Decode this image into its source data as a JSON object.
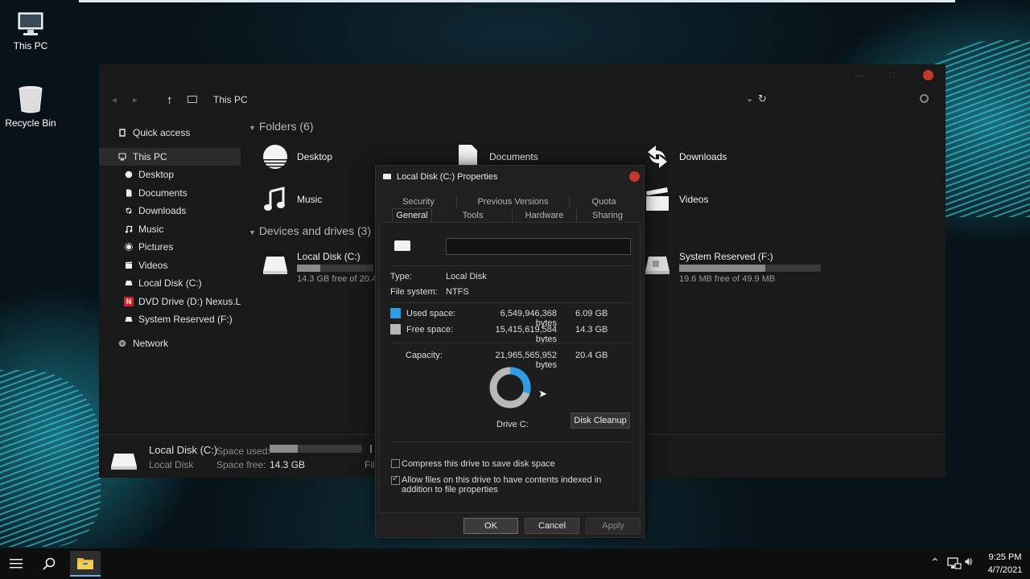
{
  "desktop": {
    "icons": [
      {
        "label": "This PC",
        "icon": "computer-icon"
      },
      {
        "label": "Recycle Bin",
        "icon": "recycle-bin-icon"
      }
    ]
  },
  "explorer": {
    "breadcrumb": "This PC",
    "nav_back_icon": "back-arrow-icon",
    "nav_forward_icon": "forward-arrow-icon",
    "up_icon": "up-arrow-icon",
    "sidebar": {
      "quick_access": "Quick access",
      "this_pc": "This PC",
      "items": [
        {
          "label": "Desktop",
          "icon": "desktop-icon"
        },
        {
          "label": "Documents",
          "icon": "document-icon"
        },
        {
          "label": "Downloads",
          "icon": "downloads-icon"
        },
        {
          "label": "Music",
          "icon": "music-icon"
        },
        {
          "label": "Pictures",
          "icon": "pictures-icon"
        },
        {
          "label": "Videos",
          "icon": "videos-icon"
        },
        {
          "label": "Local Disk (C:)",
          "icon": "drive-icon"
        },
        {
          "label": "DVD Drive (D:) Nexus.Lite",
          "icon": "dvd-drive-icon"
        },
        {
          "label": "System Reserved (F:)",
          "icon": "drive-icon"
        }
      ],
      "network": "Network"
    },
    "groups": {
      "folders_header": "Folders (6)",
      "devices_header": "Devices and drives (3)"
    },
    "folders": [
      {
        "name": "Desktop",
        "icon": "desktop-folder-icon"
      },
      {
        "name": "Documents",
        "icon": "documents-folder-icon"
      },
      {
        "name": "Downloads",
        "icon": "downloads-folder-icon"
      },
      {
        "name": "Music",
        "icon": "music-folder-icon"
      },
      {
        "name": "Videos",
        "icon": "videos-folder-icon"
      }
    ],
    "drives": [
      {
        "name": "Local Disk (C:)",
        "free_text": "14.3 GB free of 20.4",
        "used_fraction": 0.3
      },
      {
        "name": "System Reserved (F:)",
        "free_text": "19.6 MB free of 49.9 MB",
        "used_fraction": 0.61
      }
    ],
    "details": {
      "name": "Local Disk (C:)",
      "subtitle": "Local Disk",
      "space_used_label": "Space used:",
      "space_free_label": "Space free:",
      "space_free_value": "14.3 GB",
      "space_used_fraction": 0.3,
      "truncated_label": "Fil"
    }
  },
  "dialog": {
    "title": "Local Disk (C:) Properties",
    "tabs_row1": [
      "Security",
      "Previous Versions",
      "Quota"
    ],
    "tabs_row2": [
      "General",
      "Tools",
      "Hardware",
      "Sharing"
    ],
    "active_tab": "General",
    "name_value": "",
    "type_label": "Type:",
    "type_value": "Local Disk",
    "fs_label": "File system:",
    "fs_value": "NTFS",
    "used_label": "Used space:",
    "used_bytes": "6,549,946,368 bytes",
    "used_gb": "6.09 GB",
    "free_label": "Free space:",
    "free_bytes": "15,415,619,584 bytes",
    "free_gb": "14.3 GB",
    "capacity_label": "Capacity:",
    "capacity_bytes": "21,965,565,952 bytes",
    "capacity_gb": "20.4 GB",
    "drive_label": "Drive C:",
    "disk_cleanup": "Disk Cleanup",
    "compress_label": "Compress this drive to save disk space",
    "compress_checked": false,
    "index_label": "Allow files on this drive to have contents indexed in addition to file properties",
    "index_checked": true,
    "ok": "OK",
    "cancel": "Cancel",
    "apply": "Apply",
    "colors": {
      "used": "#2f9be3",
      "free": "#b8b8b8"
    }
  },
  "taskbar": {
    "time": "9:25 PM",
    "date": "4/7/2021",
    "icons": [
      "start-menu-icon",
      "search-icon",
      "file-explorer-icon",
      "chevron-up-icon",
      "network-icon",
      "volume-icon"
    ]
  }
}
